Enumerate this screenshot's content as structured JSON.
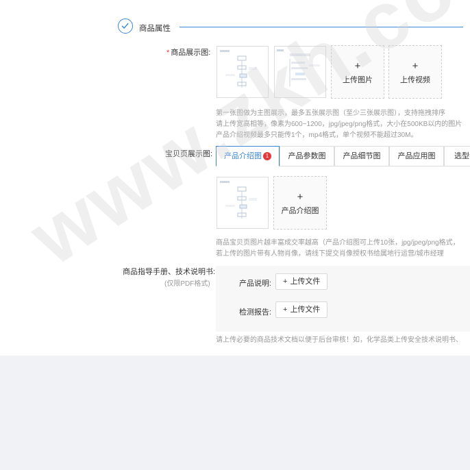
{
  "section": {
    "title": "商品属性"
  },
  "display_images": {
    "label": "商品展示图:",
    "required_mark": "*",
    "upload_image_label": "上传图片",
    "upload_video_label": "上传视频",
    "hints": [
      "第一张图做为主图展示，最多五张展示图（至少三张展示图），支持拖拽排序",
      "请上传宽高相等，像素为600~1200，jpg/jpeg/png格式，大小在500KB以内的图片",
      "产品介绍视频最多只能传1个，mp4格式，单个视频不能超过30M。"
    ]
  },
  "detail_images": {
    "label": "宝贝页展示图:",
    "tabs": [
      {
        "label": "产品介绍图",
        "badge": "1"
      },
      {
        "label": "产品参数图"
      },
      {
        "label": "产品细节图"
      },
      {
        "label": "产品应用图"
      },
      {
        "label": "选型参"
      }
    ],
    "upload_label": "产品介绍图",
    "hints": [
      "商品宝贝页图片越丰富成交率越高（产品介绍图可上传10张，jpg/jpeg/png格式，",
      "若上传的图片带有人物肖像，请线下提交肖像授权书给属地行运营/城市经理"
    ]
  },
  "manuals": {
    "label": "商品指导手册、技术说明书:",
    "sublabel": "(仅限PDF格式)",
    "rows": [
      {
        "label": "产品说明:",
        "button": "上传文件"
      },
      {
        "label": "检测报告:",
        "button": "上传文件"
      }
    ],
    "hint": "请上传必要的商品技术文档以便于后台审核！如，化学品类上传安全技术说明书、"
  },
  "watermark": "www.zkh.com",
  "colors": {
    "accent": "#3a86d8",
    "required": "#e5383b",
    "background_bottom": "#f0f2f5"
  }
}
